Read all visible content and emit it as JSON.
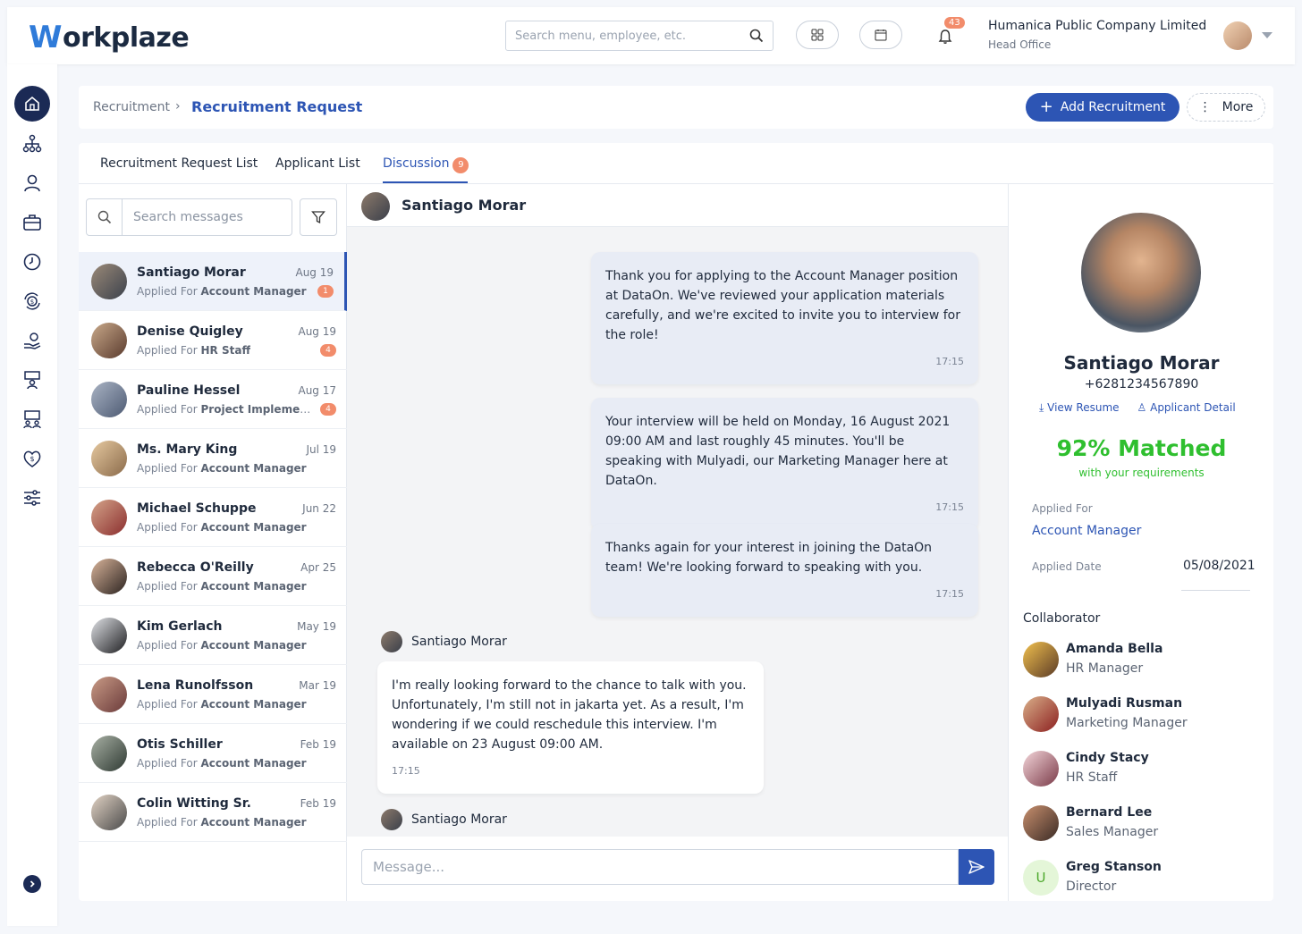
{
  "app": {
    "logo_mark": "W",
    "logo_text": "orkplaze"
  },
  "header": {
    "search_placeholder": "Search menu, employee, etc.",
    "notification_count": "43",
    "company_name": "Humanica Public Company Limited",
    "company_branch": "Head Office"
  },
  "breadcrumb": {
    "parent": "Recruitment",
    "separator": "›",
    "current": "Recruitment Request"
  },
  "actions": {
    "add_label": "Add Recruitment",
    "more_label": "More"
  },
  "tabs": [
    {
      "label": "Recruitment Request List"
    },
    {
      "label": "Applicant List"
    },
    {
      "label": "Discussion",
      "badge": "9"
    }
  ],
  "message_search": {
    "placeholder": "Search messages"
  },
  "conversations": [
    {
      "name": "Santiago Morar",
      "applied_prefix": "Applied For",
      "role": "Account Manager",
      "date": "Aug 19",
      "badge": "1"
    },
    {
      "name": "Denise Quigley",
      "applied_prefix": "Applied For",
      "role": "HR Staff",
      "date": "Aug 19",
      "badge": "4"
    },
    {
      "name": "Pauline Hessel",
      "applied_prefix": "Applied For",
      "role": "Project Implementa..",
      "date": "Aug 17",
      "badge": "4"
    },
    {
      "name": "Ms. Mary King",
      "applied_prefix": "Applied For",
      "role": "Account Manager",
      "date": "Jul 19"
    },
    {
      "name": "Michael Schuppe",
      "applied_prefix": "Applied For",
      "role": "Account Manager",
      "date": "Jun 22"
    },
    {
      "name": "Rebecca O'Reilly",
      "applied_prefix": "Applied For",
      "role": "Account Manager",
      "date": "Apr 25"
    },
    {
      "name": "Kim Gerlach",
      "applied_prefix": "Applied For",
      "role": "Account Manager",
      "date": "May 19"
    },
    {
      "name": "Lena Runolfsson",
      "applied_prefix": "Applied For",
      "role": "Account Manager",
      "date": "Mar 19"
    },
    {
      "name": "Otis Schiller",
      "applied_prefix": "Applied For",
      "role": "Account Manager",
      "date": "Feb 19"
    },
    {
      "name": "Colin Witting Sr.",
      "applied_prefix": "Applied For",
      "role": "Account Manager",
      "date": "Feb 19"
    }
  ],
  "chat": {
    "contact_name": "Santiago Morar",
    "messages": [
      {
        "text": "Thank you for applying to the Account Manager position at DataOn. We've reviewed your application materials carefully, and we're excited to invite you to interview for the role!",
        "time": "17:15"
      },
      {
        "text": "Your interview will be held on Monday, 16 August 2021 09:00 AM and last roughly 45 minutes. You'll be speaking with Mulyadi, our Marketing Manager here at DataOn.",
        "time": "17:15"
      },
      {
        "text": "Thanks again for your interest in joining the DataOn team! We're looking forward to speaking with you.",
        "time": "17:15"
      },
      {
        "sender": "Santiago Morar",
        "text": "I'm really looking forward to the chance to talk with you. Unfortunately, I'm still not in jakarta yet. As a result, I'm wondering if we could reschedule this interview. I'm available on 23 August 09:00 AM.",
        "time": "17:15"
      },
      {
        "sender": "Santiago Morar"
      }
    ],
    "composer_placeholder": "Message..."
  },
  "profile": {
    "name": "Santiago Morar",
    "phone": "+6281234567890",
    "view_resume": "View Resume",
    "applicant_detail": "Applicant Detail",
    "match": "92% Matched",
    "match_sub": "with your requirements",
    "applied_for_label": "Applied For",
    "applied_for": "Account Manager",
    "applied_date_label": "Applied Date",
    "applied_date": "05/08/2021",
    "collaborator_title": "Collaborator",
    "collaborators": [
      {
        "name": "Amanda Bella",
        "role": "HR Manager"
      },
      {
        "name": "Mulyadi Rusman",
        "role": "Marketing Manager"
      },
      {
        "name": "Cindy Stacy",
        "role": "HR Staff"
      },
      {
        "name": "Bernard Lee",
        "role": "Sales Manager"
      },
      {
        "name": "Greg Stanson",
        "role": "Director",
        "initial": "U"
      }
    ]
  },
  "colors": {
    "primary": "#2d55b4",
    "accent": "#f28c6b",
    "match": "#2fbf2f"
  }
}
